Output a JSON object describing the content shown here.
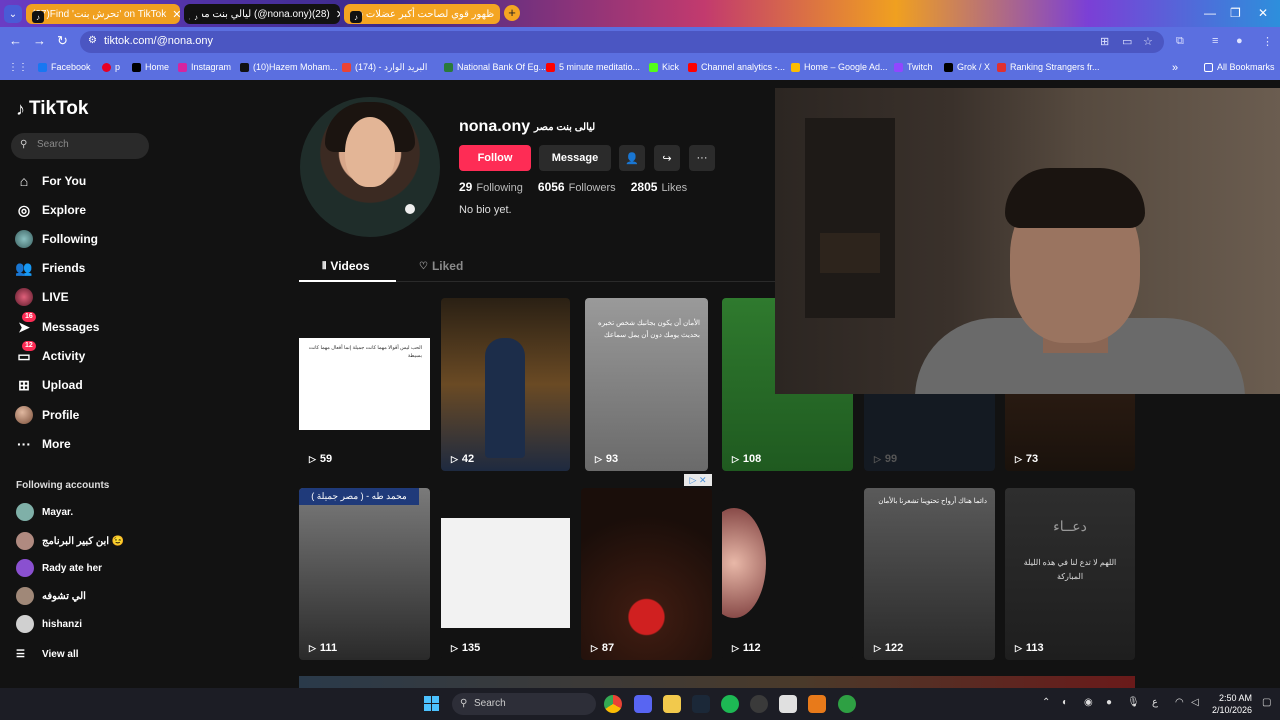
{
  "browser": {
    "tabs": [
      {
        "label": "(27)Find 'تحرش بنت' on TikTok",
        "active": false
      },
      {
        "label": "ليالي بنت مصر (@nona.ony)(28)",
        "active": true
      },
      {
        "label": "ظهور قوي لصاحت أكبر عضلات في",
        "active": false
      }
    ],
    "add_tab": "+",
    "window_controls": [
      "—",
      "❐",
      "✕"
    ],
    "url": "tiktok.com/@nona.ony",
    "bookmarks": [
      "Facebook",
      "p",
      "Home",
      "Instagram",
      "(10)Hazem Moham...",
      "(174) - البريد الوارد",
      "National Bank Of Eg...",
      "5 minute meditatio...",
      "Kick",
      "Channel analytics -...",
      "Home – Google Ad...",
      "Twitch",
      "Grok / X",
      "Ranking Strangers fr..."
    ],
    "all_bookmarks": "All Bookmarks"
  },
  "sidebar": {
    "logo": "TikTok",
    "search_placeholder": "Search",
    "items": [
      {
        "label": "For You",
        "icon": "home-icon"
      },
      {
        "label": "Explore",
        "icon": "compass-icon"
      },
      {
        "label": "Following",
        "icon": "avatar-icon"
      },
      {
        "label": "Friends",
        "icon": "friends-icon"
      },
      {
        "label": "LIVE",
        "icon": "live-icon"
      },
      {
        "label": "Messages",
        "icon": "send-icon",
        "badge": "16"
      },
      {
        "label": "Activity",
        "icon": "inbox-icon",
        "badge": "12"
      },
      {
        "label": "Upload",
        "icon": "plus-square-icon"
      },
      {
        "label": "Profile",
        "icon": "avatar-icon"
      },
      {
        "label": "More",
        "icon": "more-icon"
      }
    ],
    "following_title": "Following accounts",
    "following": [
      {
        "name": "Mayar.",
        "color": "#7fb0a8"
      },
      {
        "name": "ابن كبير البرنامج 😉",
        "color": "#b08a80"
      },
      {
        "name": "Rady ate her",
        "color": "#8a50d0"
      },
      {
        "name": "الي تشوفه",
        "color": "#a08878"
      },
      {
        "name": "hishanzi",
        "color": "#d0d0d0"
      }
    ],
    "view_all": "View all"
  },
  "profile": {
    "username": "nona.ony",
    "nickname": "ليالى بنت مصر",
    "follow_label": "Follow",
    "message_label": "Message",
    "following_count": "29",
    "following_label": "Following",
    "followers_count": "6056",
    "followers_label": "Followers",
    "likes_count": "2805",
    "likes_label": "Likes",
    "bio": "No bio yet.",
    "tab_videos": "Videos",
    "tab_liked": "Liked"
  },
  "videos": [
    {
      "views": "59",
      "bg": "#ffffff"
    },
    {
      "views": "42",
      "bg": "#3a2a1a"
    },
    {
      "views": "93",
      "bg": "#8a8a8a"
    },
    {
      "views": "108",
      "bg": "#2e6a2a"
    },
    {
      "views": "99",
      "bg": "#141a22"
    },
    {
      "views": "73",
      "bg": "#2a1a14"
    },
    {
      "views": "111",
      "bg": "#5a5a5a"
    },
    {
      "views": "135",
      "bg": "#f2f2f2"
    },
    {
      "views": "87",
      "bg": "#3a1a10"
    },
    {
      "views": "112",
      "bg": "#1a1414"
    },
    {
      "views": "122",
      "bg": "#4a4a4a"
    },
    {
      "views": "113",
      "bg": "#2a2a2a"
    }
  ],
  "video_overlays": {
    "v7_caption": "( مصر جميلة ) - محمد طه",
    "v11_text": "دائما هناك أرواح تحتوينا تشعرنا بالأمان",
    "v12_title": "دعــاء",
    "v12_text": "اللهم لا تدع لنا في هذه الليلة المباركة",
    "v1_text": "الحب ليس أقوالا مهما كانت جميلة إنما أفعال مهما كانت بسيطة",
    "v3_text": "الأمان أن يكون بجانبك شخص تخبره بحديث يومك دون أن يمل سماعك"
  },
  "taskbar": {
    "search_placeholder": "Search",
    "lang": "ع",
    "time": "2:50 AM",
    "date": "2/10/2026"
  }
}
